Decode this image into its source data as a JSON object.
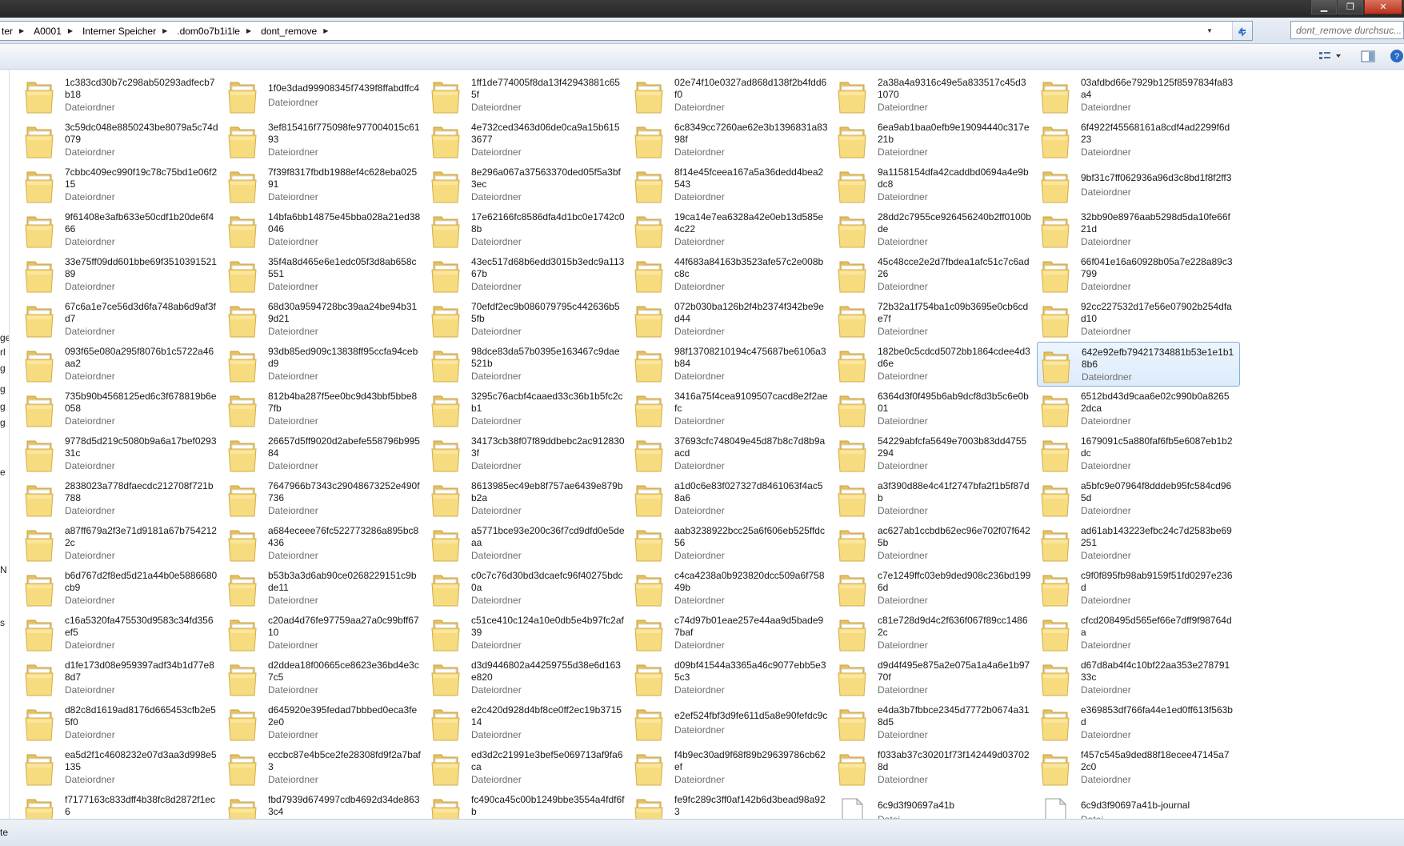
{
  "window": {
    "minimize": "▁",
    "maximize": "❐",
    "close": "✕"
  },
  "address": {
    "crumbs": [
      "ter",
      "A0001",
      "Interner Speicher",
      ".dom0o7b1i1le",
      "dont_remove"
    ],
    "search_placeholder": "dont_remove durchsuc..."
  },
  "toolbar": {
    "view_icon": "view-options-icon",
    "pane_icon": "preview-pane-icon",
    "help_icon": "help-icon"
  },
  "left_strip": [
    "ge",
    "rl",
    "g",
    "g",
    "g",
    "g",
    "e",
    "N",
    "s"
  ],
  "status": {
    "text": "te"
  },
  "items": [
    {
      "name": "1c383cd30b7c298ab50293adfecb7b18",
      "type": "Dateiordner"
    },
    {
      "name": "1f0e3dad99908345f7439f8ffabdffc4",
      "type": "Dateiordner"
    },
    {
      "name": "1ff1de774005f8da13f42943881c655f",
      "type": "Dateiordner"
    },
    {
      "name": "02e74f10e0327ad868d138f2b4fdd6f0",
      "type": "Dateiordner"
    },
    {
      "name": "2a38a4a9316c49e5a833517c45d31070",
      "type": "Dateiordner"
    },
    {
      "name": "03afdbd66e7929b125f8597834fa83a4",
      "type": "Dateiordner"
    },
    {
      "name": "3c59dc048e8850243be8079a5c74d079",
      "type": "Dateiordner"
    },
    {
      "name": "3ef815416f775098fe977004015c6193",
      "type": "Dateiordner"
    },
    {
      "name": "4e732ced3463d06de0ca9a15b6153677",
      "type": "Dateiordner"
    },
    {
      "name": "6c8349cc7260ae62e3b1396831a8398f",
      "type": "Dateiordner"
    },
    {
      "name": "6ea9ab1baa0efb9e19094440c317e21b",
      "type": "Dateiordner"
    },
    {
      "name": "6f4922f45568161a8cdf4ad2299f6d23",
      "type": "Dateiordner"
    },
    {
      "name": "7cbbc409ec990f19c78c75bd1e06f215",
      "type": "Dateiordner"
    },
    {
      "name": "7f39f8317fbdb1988ef4c628eba02591",
      "type": "Dateiordner"
    },
    {
      "name": "8e296a067a37563370ded05f5a3bf3ec",
      "type": "Dateiordner"
    },
    {
      "name": "8f14e45fceea167a5a36dedd4bea2543",
      "type": "Dateiordner"
    },
    {
      "name": "9a1158154dfa42caddbd0694a4e9bdc8",
      "type": "Dateiordner"
    },
    {
      "name": "9bf31c7ff062936a96d3c8bd1f8f2ff3",
      "type": "Dateiordner"
    },
    {
      "name": "9f61408e3afb633e50cdf1b20de6f466",
      "type": "Dateiordner"
    },
    {
      "name": "14bfa6bb14875e45bba028a21ed38046",
      "type": "Dateiordner"
    },
    {
      "name": "17e62166fc8586dfa4d1bc0e1742c08b",
      "type": "Dateiordner"
    },
    {
      "name": "19ca14e7ea6328a42e0eb13d585e4c22",
      "type": "Dateiordner"
    },
    {
      "name": "28dd2c7955ce926456240b2ff0100bde",
      "type": "Dateiordner"
    },
    {
      "name": "32bb90e8976aab5298d5da10fe66f21d",
      "type": "Dateiordner"
    },
    {
      "name": "33e75ff09dd601bbe69f351039152189",
      "type": "Dateiordner"
    },
    {
      "name": "35f4a8d465e6e1edc05f3d8ab658c551",
      "type": "Dateiordner"
    },
    {
      "name": "43ec517d68b6edd3015b3edc9a11367b",
      "type": "Dateiordner"
    },
    {
      "name": "44f683a84163b3523afe57c2e008bc8c",
      "type": "Dateiordner"
    },
    {
      "name": "45c48cce2e2d7fbdea1afc51c7c6ad26",
      "type": "Dateiordner"
    },
    {
      "name": "66f041e16a60928b05a7e228a89c3799",
      "type": "Dateiordner"
    },
    {
      "name": "67c6a1e7ce56d3d6fa748ab6d9af3fd7",
      "type": "Dateiordner"
    },
    {
      "name": "68d30a9594728bc39aa24be94b319d21",
      "type": "Dateiordner"
    },
    {
      "name": "70efdf2ec9b086079795c442636b55fb",
      "type": "Dateiordner"
    },
    {
      "name": "072b030ba126b2f4b2374f342be9ed44",
      "type": "Dateiordner"
    },
    {
      "name": "72b32a1f754ba1c09b3695e0cb6cde7f",
      "type": "Dateiordner"
    },
    {
      "name": "92cc227532d17e56e07902b254dfad10",
      "type": "Dateiordner"
    },
    {
      "name": "093f65e080a295f8076b1c5722a46aa2",
      "type": "Dateiordner"
    },
    {
      "name": "93db85ed909c13838ff95ccfa94cebd9",
      "type": "Dateiordner"
    },
    {
      "name": "98dce83da57b0395e163467c9dae521b",
      "type": "Dateiordner"
    },
    {
      "name": "98f13708210194c475687be6106a3b84",
      "type": "Dateiordner"
    },
    {
      "name": "182be0c5cdcd5072bb1864cdee4d3d6e",
      "type": "Dateiordner"
    },
    {
      "name": "642e92efb79421734881b53e1e1b18b6",
      "type": "Dateiordner",
      "selected": true
    },
    {
      "name": "735b90b4568125ed6c3f678819b6e058",
      "type": "Dateiordner"
    },
    {
      "name": "812b4ba287f5ee0bc9d43bbf5bbe87fb",
      "type": "Dateiordner"
    },
    {
      "name": "3295c76acbf4caaed33c36b1b5fc2cb1",
      "type": "Dateiordner"
    },
    {
      "name": "3416a75f4cea9109507cacd8e2f2aefc",
      "type": "Dateiordner"
    },
    {
      "name": "6364d3f0f495b6ab9dcf8d3b5c6e0b01",
      "type": "Dateiordner"
    },
    {
      "name": "6512bd43d9caa6e02c990b0a82652dca",
      "type": "Dateiordner"
    },
    {
      "name": "9778d5d219c5080b9a6a17bef029331c",
      "type": "Dateiordner"
    },
    {
      "name": "26657d5ff9020d2abefe558796b99584",
      "type": "Dateiordner"
    },
    {
      "name": "34173cb38f07f89ddbebc2ac9128303f",
      "type": "Dateiordner"
    },
    {
      "name": "37693cfc748049e45d87b8c7d8b9aacd",
      "type": "Dateiordner"
    },
    {
      "name": "54229abfcfa5649e7003b83dd4755294",
      "type": "Dateiordner"
    },
    {
      "name": "1679091c5a880faf6fb5e6087eb1b2dc",
      "type": "Dateiordner"
    },
    {
      "name": "2838023a778dfaecdc212708f721b788",
      "type": "Dateiordner"
    },
    {
      "name": "7647966b7343c29048673252e490f736",
      "type": "Dateiordner"
    },
    {
      "name": "8613985ec49eb8f757ae6439e879bb2a",
      "type": "Dateiordner"
    },
    {
      "name": "a1d0c6e83f027327d8461063f4ac58a6",
      "type": "Dateiordner"
    },
    {
      "name": "a3f390d88e4c41f2747bfa2f1b5f87db",
      "type": "Dateiordner"
    },
    {
      "name": "a5bfc9e07964f8dddeb95fc584cd965d",
      "type": "Dateiordner"
    },
    {
      "name": "a87ff679a2f3e71d9181a67b7542122c",
      "type": "Dateiordner"
    },
    {
      "name": "a684eceee76fc522773286a895bc8436",
      "type": "Dateiordner"
    },
    {
      "name": "a5771bce93e200c36f7cd9dfd0e5deaa",
      "type": "Dateiordner"
    },
    {
      "name": "aab3238922bcc25a6f606eb525ffdc56",
      "type": "Dateiordner"
    },
    {
      "name": "ac627ab1ccbdb62ec96e702f07f6425b",
      "type": "Dateiordner"
    },
    {
      "name": "ad61ab143223efbc24c7d2583be69251",
      "type": "Dateiordner"
    },
    {
      "name": "b6d767d2f8ed5d21a44b0e5886680cb9",
      "type": "Dateiordner"
    },
    {
      "name": "b53b3a3d6ab90ce0268229151c9bde11",
      "type": "Dateiordner"
    },
    {
      "name": "c0c7c76d30bd3dcaefc96f40275bdc0a",
      "type": "Dateiordner"
    },
    {
      "name": "c4ca4238a0b923820dcc509a6f75849b",
      "type": "Dateiordner"
    },
    {
      "name": "c7e1249ffc03eb9ded908c236bd1996d",
      "type": "Dateiordner"
    },
    {
      "name": "c9f0f895fb98ab9159f51fd0297e236d",
      "type": "Dateiordner"
    },
    {
      "name": "c16a5320fa475530d9583c34fd356ef5",
      "type": "Dateiordner"
    },
    {
      "name": "c20ad4d76fe97759aa27a0c99bff6710",
      "type": "Dateiordner"
    },
    {
      "name": "c51ce410c124a10e0db5e4b97fc2af39",
      "type": "Dateiordner"
    },
    {
      "name": "c74d97b01eae257e44aa9d5bade97baf",
      "type": "Dateiordner"
    },
    {
      "name": "c81e728d9d4c2f636f067f89cc14862c",
      "type": "Dateiordner"
    },
    {
      "name": "cfcd208495d565ef66e7dff9f98764da",
      "type": "Dateiordner"
    },
    {
      "name": "d1fe173d08e959397adf34b1d77e88d7",
      "type": "Dateiordner"
    },
    {
      "name": "d2ddea18f00665ce8623e36bd4e3c7c5",
      "type": "Dateiordner"
    },
    {
      "name": "d3d9446802a44259755d38e6d163e820",
      "type": "Dateiordner"
    },
    {
      "name": "d09bf41544a3365a46c9077ebb5e35c3",
      "type": "Dateiordner"
    },
    {
      "name": "d9d4f495e875a2e075a1a4a6e1b9770f",
      "type": "Dateiordner"
    },
    {
      "name": "d67d8ab4f4c10bf22aa353e27879133c",
      "type": "Dateiordner"
    },
    {
      "name": "d82c8d1619ad8176d665453cfb2e55f0",
      "type": "Dateiordner"
    },
    {
      "name": "d645920e395fedad7bbbed0eca3fe2e0",
      "type": "Dateiordner"
    },
    {
      "name": "e2c420d928d4bf8ce0ff2ec19b371514",
      "type": "Dateiordner"
    },
    {
      "name": "e2ef524fbf3d9fe611d5a8e90fefdc9c",
      "type": "Dateiordner"
    },
    {
      "name": "e4da3b7fbbce2345d7772b0674a318d5",
      "type": "Dateiordner"
    },
    {
      "name": "e369853df766fa44e1ed0ff613f563bd",
      "type": "Dateiordner"
    },
    {
      "name": "ea5d2f1c4608232e07d3aa3d998e5135",
      "type": "Dateiordner"
    },
    {
      "name": "eccbc87e4b5ce2fe28308fd9f2a7baf3",
      "type": "Dateiordner"
    },
    {
      "name": "ed3d2c21991e3bef5e069713af9fa6ca",
      "type": "Dateiordner"
    },
    {
      "name": "f4b9ec30ad9f68f89b29639786cb62ef",
      "type": "Dateiordner"
    },
    {
      "name": "f033ab37c30201f73f142449d037028d",
      "type": "Dateiordner"
    },
    {
      "name": "f457c545a9ded88f18ecee47145a72c0",
      "type": "Dateiordner"
    },
    {
      "name": "f7177163c833dff4b38fc8d2872f1ec6",
      "type": "Dateiordner"
    },
    {
      "name": "fbd7939d674997cdb4692d34de8633c4",
      "type": "Dateiordner"
    },
    {
      "name": "fc490ca45c00b1249bbe3554a4fdf6fb",
      "type": "Dateiordner"
    },
    {
      "name": "fe9fc289c3ff0af142b6d3bead98a923",
      "type": "Dateiordner"
    },
    {
      "name": "6c9d3f90697a41b",
      "type": "Datei",
      "file": true
    },
    {
      "name": "6c9d3f90697a41b-journal",
      "type": "Datei",
      "file": true
    }
  ]
}
